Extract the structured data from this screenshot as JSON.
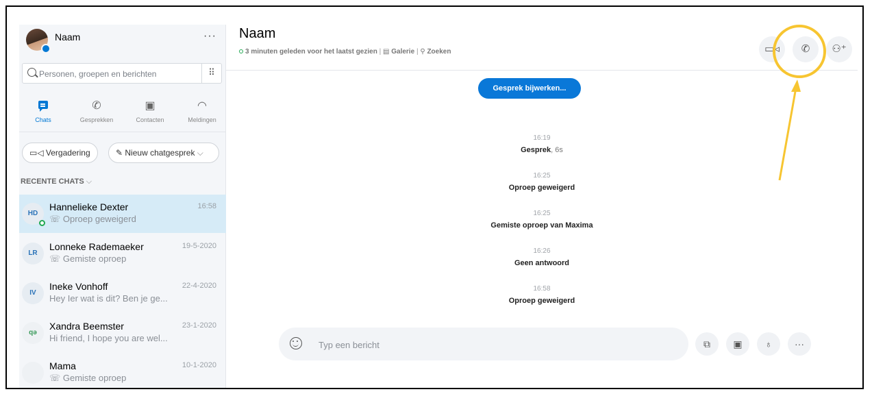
{
  "profile": {
    "name": "Naam",
    "more": "···"
  },
  "search": {
    "placeholder": "Personen, groepen en berichten",
    "dialpad": "⠿"
  },
  "nav": {
    "chats": "Chats",
    "calls": "Gesprekken",
    "contacts": "Contacten",
    "notifications": "Meldingen"
  },
  "actions": {
    "meeting": "Vergadering",
    "new_chat": "Nieuw chatgesprek"
  },
  "recent_header": "RECENTE CHATS",
  "chats": [
    {
      "initials": "HD",
      "name": "Hannelieke Dexter",
      "date": "16:58",
      "preview": "☏ Oproep geweigerd"
    },
    {
      "initials": "LR",
      "name": "Lonneke Rademaeker",
      "date": "19-5-2020",
      "preview": "☏ Gemiste oproep"
    },
    {
      "initials": "IV",
      "name": "Ineke Vonhoff",
      "date": "22-4-2020",
      "preview": "Hey Ier wat is dit? Ben je ge..."
    },
    {
      "initials": "qə",
      "name": "Xandra Beemster",
      "date": "23-1-2020",
      "preview": "Hi friend, I hope you are wel..."
    },
    {
      "initials": "",
      "name": "Mama",
      "date": "10-1-2020",
      "preview": "☏ Gemiste oproep"
    }
  ],
  "conversation": {
    "title": "Naam",
    "last_seen": "3 minuten geleden voor het laatst gezien",
    "gallery": "Galerie",
    "search": "Zoeken",
    "update_button": "Gesprek bijwerken...",
    "events": [
      {
        "time": "16:19",
        "text": "Gesprek",
        "duration": ", 6s"
      },
      {
        "time": "16:25",
        "text": "Oproep geweigerd",
        "duration": ""
      },
      {
        "time": "16:25",
        "text": "Gemiste oproep van  Maxima",
        "duration": ""
      },
      {
        "time": "16:26",
        "text": "Geen antwoord",
        "duration": ""
      },
      {
        "time": "16:58",
        "text": "Oproep geweigerd",
        "duration": ""
      }
    ]
  },
  "composer": {
    "placeholder": "Typ een bericht"
  },
  "colors": {
    "accent": "#0078d4",
    "highlight_circle": "#f7c531",
    "active_chat_bg": "#d6ebf7"
  },
  "icons": {
    "video_call": "video-camera-icon",
    "audio_call": "phone-icon",
    "add_people": "add-person-icon"
  }
}
